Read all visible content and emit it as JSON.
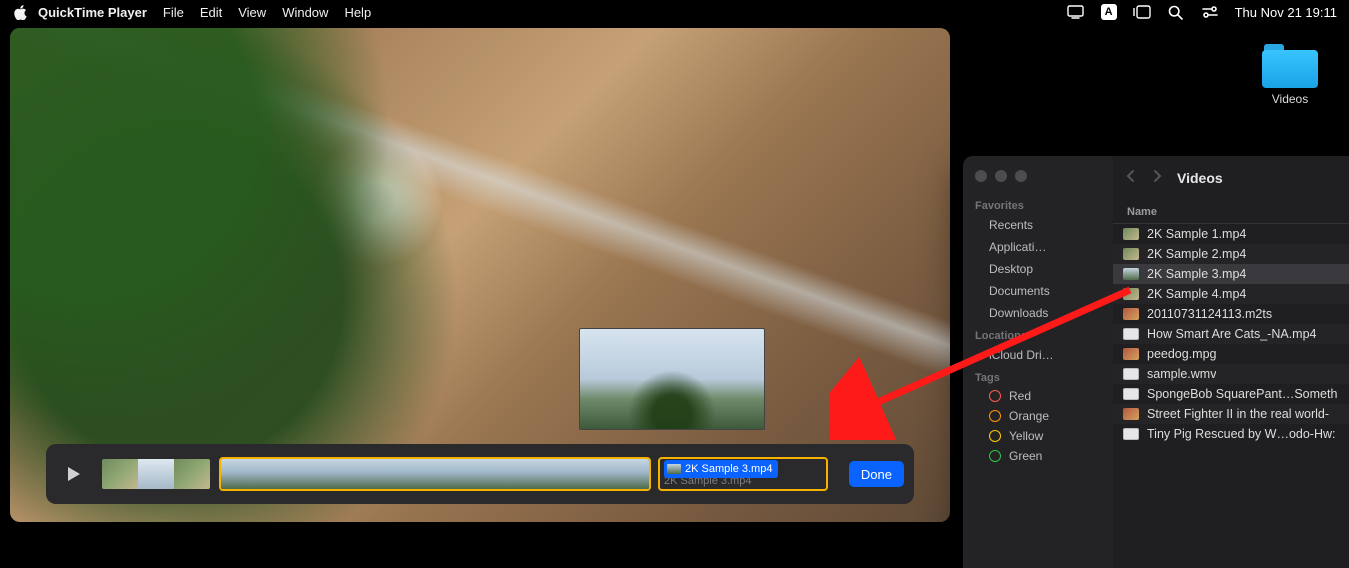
{
  "menubar": {
    "app_name": "QuickTime Player",
    "items": [
      "File",
      "Edit",
      "View",
      "Window",
      "Help"
    ],
    "input_badge": "A",
    "clock": "Thu Nov 21  19:11"
  },
  "desktop": {
    "folder_label": "Videos"
  },
  "quicktime": {
    "done_label": "Done",
    "drop_chip_label": "2K Sample 3.mp4",
    "drop_ghost_label": "2K Sample 3.mp4"
  },
  "finder": {
    "title": "Videos",
    "column_header": "Name",
    "sidebar": {
      "favorites_label": "Favorites",
      "favorites": [
        "Recents",
        "Applicati…",
        "Desktop",
        "Documents",
        "Downloads"
      ],
      "locations_label": "Locations",
      "locations": [
        "iCloud Dri…"
      ],
      "tags_label": "Tags",
      "tags": [
        "Red",
        "Orange",
        "Yellow",
        "Green"
      ]
    },
    "files": [
      {
        "name": "2K Sample 1.mp4",
        "icon": "ico-vid1",
        "selected": false
      },
      {
        "name": "2K Sample 2.mp4",
        "icon": "ico-vid1",
        "selected": false
      },
      {
        "name": "2K Sample 3.mp4",
        "icon": "ico-vid2",
        "selected": true
      },
      {
        "name": "2K Sample 4.mp4",
        "icon": "ico-vid1",
        "selected": false
      },
      {
        "name": "20110731124113.m2ts",
        "icon": "ico-img",
        "selected": false
      },
      {
        "name": "How Smart Are Cats_-NA.mp4",
        "icon": "ico-doc",
        "selected": false
      },
      {
        "name": "peedog.mpg",
        "icon": "ico-img",
        "selected": false
      },
      {
        "name": "sample.wmv",
        "icon": "ico-doc",
        "selected": false
      },
      {
        "name": "SpongeBob SquarePant…Someth",
        "icon": "ico-doc",
        "selected": false
      },
      {
        "name": "Street Fighter II in the real world-",
        "icon": "ico-img",
        "selected": false
      },
      {
        "name": "Tiny Pig Rescued by W…odo-Hw:",
        "icon": "ico-doc",
        "selected": false
      }
    ]
  }
}
